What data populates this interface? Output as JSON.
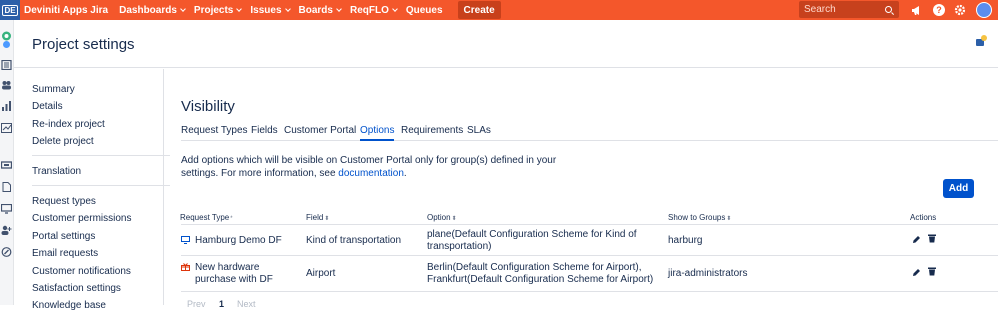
{
  "topbar": {
    "logo_text": "DE",
    "app_title": "Deviniti Apps Jira",
    "nav": [
      {
        "label": "Dashboards",
        "has_menu": true
      },
      {
        "label": "Projects",
        "has_menu": true
      },
      {
        "label": "Issues",
        "has_menu": true
      },
      {
        "label": "Boards",
        "has_menu": true
      },
      {
        "label": "ReqFLO",
        "has_menu": true
      },
      {
        "label": "Queues",
        "has_menu": false
      }
    ],
    "create_label": "Create",
    "search_placeholder": "Search",
    "help_glyph": "?",
    "colors": {
      "brand": "#f4572b",
      "create": "#c8401b"
    }
  },
  "header": {
    "title": "Project settings",
    "feedback_count": "1"
  },
  "sidebar": {
    "groups": [
      [
        "Summary",
        "Details",
        "Re-index project",
        "Delete project"
      ],
      [
        "Translation"
      ],
      [
        "Request types",
        "Customer permissions",
        "Portal settings",
        "Email requests",
        "Customer notifications",
        "Satisfaction settings",
        "Knowledge base"
      ]
    ]
  },
  "main": {
    "title": "Visibility",
    "tabs": [
      {
        "label": "Request Types",
        "active": false
      },
      {
        "label": "Fields",
        "active": false
      },
      {
        "label": "Customer Portal",
        "active": false
      },
      {
        "label": "Options",
        "active": true
      },
      {
        "label": "Requirements",
        "active": false
      },
      {
        "label": "SLAs",
        "active": false
      }
    ],
    "description_before": "Add options which will be visible on Customer Portal only for group(s) defined in your settings. For more information, see ",
    "description_link": "documentation",
    "description_after": ".",
    "add_label": "Add",
    "table": {
      "headers": [
        "Request Type",
        "Field",
        "Option",
        "Show to Groups",
        "Actions"
      ],
      "required_mark": "*",
      "sort_glyph": "⬍",
      "rows": [
        {
          "request_type": "Hamburg Demo DF",
          "request_type_icon": "monitor-icon",
          "field": "Kind of transportation",
          "option": "plane(Default Configuration Scheme for Kind of transportation)",
          "groups": "harburg"
        },
        {
          "request_type": "New hardware purchase with DF",
          "request_type_icon": "gift-icon",
          "field": "Airport",
          "option": "Berlin(Default Configuration Scheme for Airport), Frankfurt(Default Configuration Scheme for Airport)",
          "groups": "jira-administrators"
        }
      ]
    },
    "pagination": {
      "prev": "Prev",
      "current": "1",
      "next": "Next"
    }
  }
}
